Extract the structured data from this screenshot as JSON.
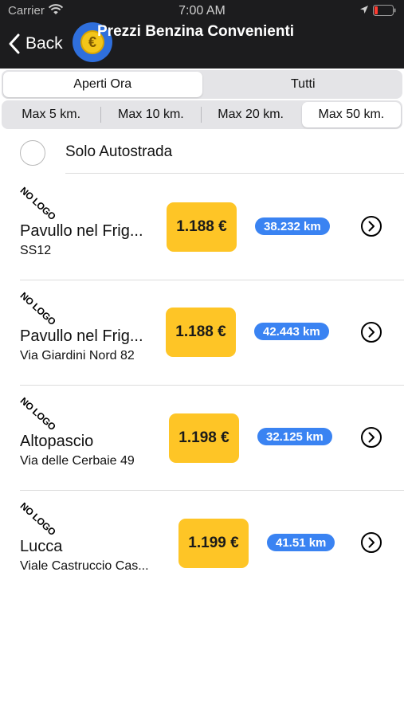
{
  "status_bar": {
    "carrier": "Carrier",
    "time": "7:00 AM"
  },
  "header": {
    "back_label": "Back",
    "title": "Prezzi Benzina Convenienti",
    "logo_symbol": "€"
  },
  "tabs": {
    "items": [
      {
        "label": "Aperti Ora",
        "selected": true
      },
      {
        "label": "Tutti",
        "selected": false
      }
    ]
  },
  "distance_filter": {
    "items": [
      {
        "label": "Max 5 km.",
        "selected": false
      },
      {
        "label": "Max 10 km.",
        "selected": false
      },
      {
        "label": "Max 20 km.",
        "selected": false
      },
      {
        "label": "Max 50 km.",
        "selected": true
      }
    ]
  },
  "solo_autostrada": {
    "label": "Solo Autostrada",
    "checked": false
  },
  "stations": [
    {
      "logo_text": "NO LOGO",
      "city": "Pavullo nel Frig...",
      "address": "SS12",
      "price": "1.188 €",
      "distance": "38.232 km"
    },
    {
      "logo_text": "NO LOGO",
      "city": "Pavullo nel Frig...",
      "address": "Via Giardini Nord 82",
      "price": "1.188 €",
      "distance": "42.443 km"
    },
    {
      "logo_text": "NO LOGO",
      "city": "Altopascio",
      "address": "Via delle Cerbaie 49",
      "price": "1.198 €",
      "distance": "32.125 km"
    },
    {
      "logo_text": "NO LOGO",
      "city": "Lucca",
      "address": "Viale Castruccio Cas...",
      "price": "1.199 €",
      "distance": "41.51 km"
    }
  ],
  "colors": {
    "header_bg": "#1c1c1e",
    "price_badge": "#fec526",
    "distance_badge": "#3a83f2"
  },
  "icons": {
    "back": "chevron-left-icon",
    "row_action": "chevron-right-circle-icon",
    "wifi": "wifi-icon",
    "location": "location-arrow-icon",
    "battery": "battery-icon"
  }
}
